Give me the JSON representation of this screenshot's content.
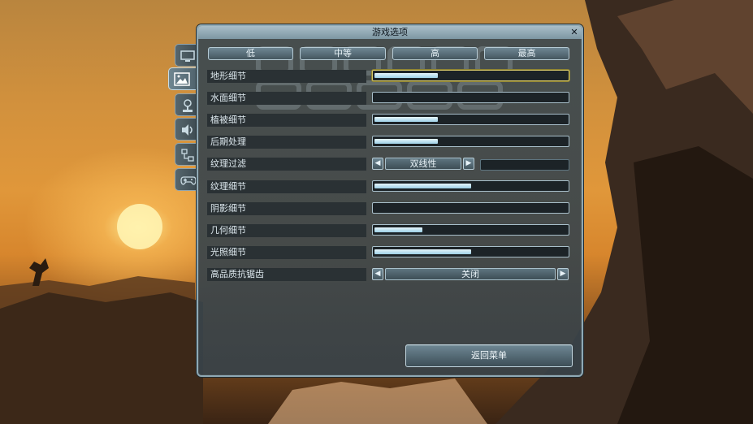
{
  "dialog": {
    "title": "游戏选项",
    "close_label": "✕"
  },
  "presets": [
    "低",
    "中等",
    "高",
    "最高"
  ],
  "side_tabs": [
    {
      "icon": "monitor-icon"
    },
    {
      "icon": "image-icon",
      "active": true
    },
    {
      "icon": "joystick-icon"
    },
    {
      "icon": "speaker-icon"
    },
    {
      "icon": "network-icon"
    },
    {
      "icon": "gamepad-icon"
    }
  ],
  "settings": {
    "terrain": {
      "label": "地形细节",
      "level": 0.33
    },
    "water": {
      "label": "水面细节",
      "level": 0.0
    },
    "vegetation": {
      "label": "植被细节",
      "level": 0.33
    },
    "postprocess": {
      "label": "后期处理",
      "level": 0.33
    },
    "texture_filter": {
      "label": "纹理过滤",
      "value": "双线性",
      "prev": "◀",
      "next": "▶"
    },
    "texture_detail": {
      "label": "纹理细节",
      "level": 0.5
    },
    "shadow": {
      "label": "阴影细节",
      "level": 0.0
    },
    "geometry": {
      "label": "几何细节",
      "level": 0.25
    },
    "lighting": {
      "label": "光照细节",
      "level": 0.5
    },
    "antialias": {
      "label": "高品质抗锯齿",
      "value": "关闭",
      "prev": "◀",
      "next": "▶"
    }
  },
  "back_button": "返回菜单",
  "colors": {
    "accent": "#9dd0e6",
    "panel": "#3e4a50",
    "focus": "#d8c96a"
  }
}
